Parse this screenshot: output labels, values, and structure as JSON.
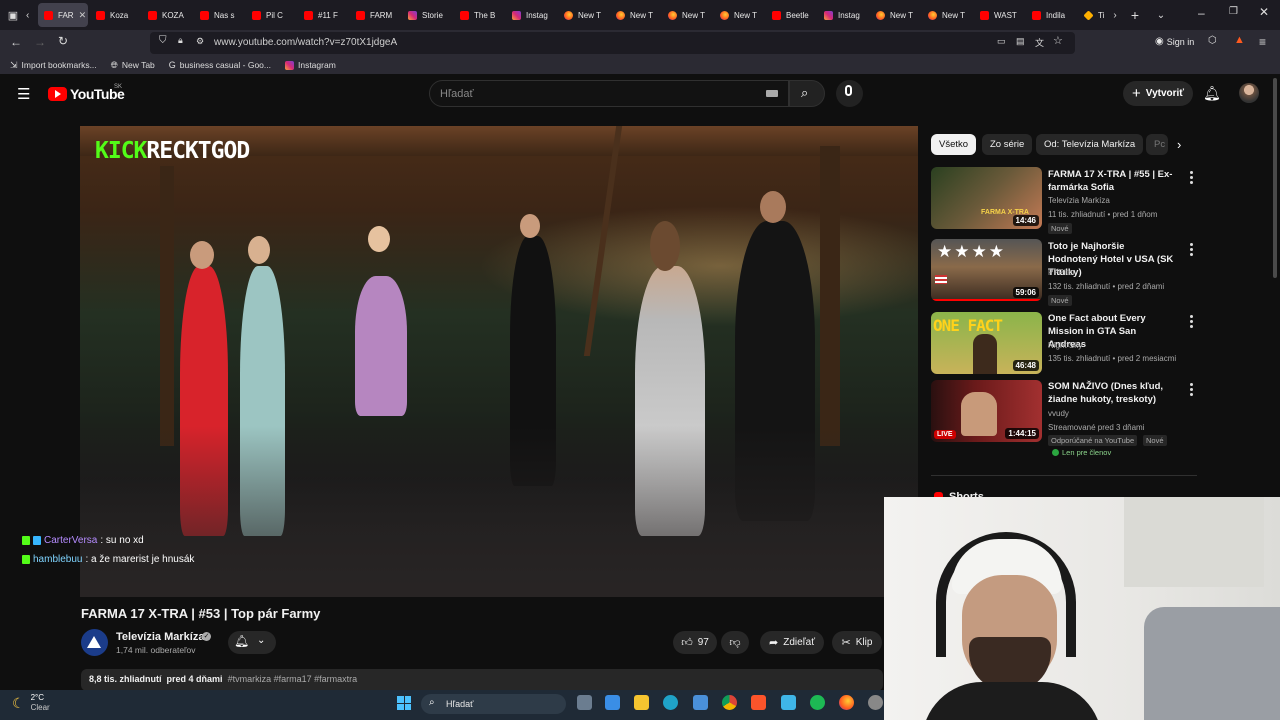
{
  "browser": {
    "tabs": [
      {
        "label": "FAR",
        "favicon": "youtube-icon",
        "active": true
      },
      {
        "label": "Koza",
        "favicon": "youtube-icon"
      },
      {
        "label": "KOZA",
        "favicon": "youtube-icon"
      },
      {
        "label": "Nas s",
        "favicon": "youtube-icon"
      },
      {
        "label": "Pil C",
        "favicon": "youtube-icon"
      },
      {
        "label": "#11 F",
        "favicon": "youtube-icon"
      },
      {
        "label": "FARM",
        "favicon": "youtube-icon"
      },
      {
        "label": "Storie",
        "favicon": "instagram-icon"
      },
      {
        "label": "The B",
        "favicon": "youtube-icon"
      },
      {
        "label": "Instag",
        "favicon": "instagram-icon"
      },
      {
        "label": "New T",
        "favicon": "firefox-icon"
      },
      {
        "label": "New T",
        "favicon": "firefox-icon"
      },
      {
        "label": "New T",
        "favicon": "firefox-icon"
      },
      {
        "label": "New T",
        "favicon": "firefox-icon"
      },
      {
        "label": "Beetle",
        "favicon": "youtube-icon"
      },
      {
        "label": "Instag",
        "favicon": "instagram-icon"
      },
      {
        "label": "New T",
        "favicon": "firefox-icon"
      },
      {
        "label": "New T",
        "favicon": "firefox-icon"
      },
      {
        "label": "WAST",
        "favicon": "youtube-icon"
      },
      {
        "label": "Indila",
        "favicon": "youtube-icon"
      },
      {
        "label": "Ti",
        "favicon": "brave-icon"
      }
    ],
    "url": "www.youtube.com/watch?v=z70tX1jdgeA",
    "sign_in": "Sign in",
    "bookmarks": [
      {
        "label": "Import bookmarks...",
        "icon": "import-icon"
      },
      {
        "label": "New Tab",
        "icon": "globe-icon"
      },
      {
        "label": "business casual - Goo...",
        "icon": "google-icon"
      },
      {
        "label": "Instagram",
        "icon": "instagram-icon"
      }
    ]
  },
  "youtube": {
    "logo_text": "YouTube",
    "country_code": "SK",
    "search_placeholder": "Hľadať",
    "create_label": "Vytvoriť"
  },
  "video": {
    "overlay_brand": "KICK",
    "overlay_name": "RECKTGOD",
    "chat": [
      {
        "user": "CarterVersa",
        "message": ": su no xd"
      },
      {
        "user": "hamblebuu",
        "message": ": a že marerist je hnusák"
      }
    ],
    "title": "FARMA 17 X-TRA | #53 | Top pár Farmy",
    "channel": "Televízia Markíza",
    "subscribers": "1,74 mil. odberateľov",
    "likes": "97",
    "share_label": "Zdieľať",
    "clip_label": "Klip",
    "views": "8,8 tis. zhliadnutí",
    "age": "pred 4 dňami",
    "hashtags": "#tvmarkiza #farma17 #farmaxtra"
  },
  "sidebar": {
    "chips": [
      "Všetko",
      "Zo série",
      "Od: Televízia Markíza",
      "Pc"
    ],
    "recommendations": [
      {
        "title": "FARMA 17 X-TRA | #55 | Ex-farmárka Sofia",
        "channel": "Televízia Markíza",
        "meta": "11 tis. zhliadnutí • pred 1 dňom",
        "badge": "Nové",
        "duration": "14:46",
        "thumb_text": "FARMA X-TRA"
      },
      {
        "title": "Toto je Najhoršie Hodnotený Hotel v USA (SK Titulky)",
        "channel": "PPPiter",
        "meta": "132 tis. zhliadnutí • pred 2 dňami",
        "badge": "Nové",
        "duration": "59:06",
        "thumb_text": ""
      },
      {
        "title": "One Fact about Every Mission in GTA San Andreas",
        "channel": "Night Sky",
        "meta": "135 tis. zhliadnutí • pred 2 mesiacmi",
        "badge": "",
        "duration": "46:48",
        "thumb_text": "ONE FACT"
      },
      {
        "title": "SOM NAŽIVO (Dnes kľud, žiadne hukoty, treskoty)",
        "channel": "vvudy",
        "meta": "Streamované pred 3 dňami",
        "badge": "Nové",
        "extra_badge": "Odporúčané na YouTube",
        "members": "Len pre členov",
        "duration": "1:44:15",
        "live": "LIVE"
      }
    ],
    "shorts_label": "Shorts"
  },
  "taskbar": {
    "weather_temp": "2°C",
    "weather_desc": "Clear",
    "search_placeholder": "Hľadať"
  }
}
